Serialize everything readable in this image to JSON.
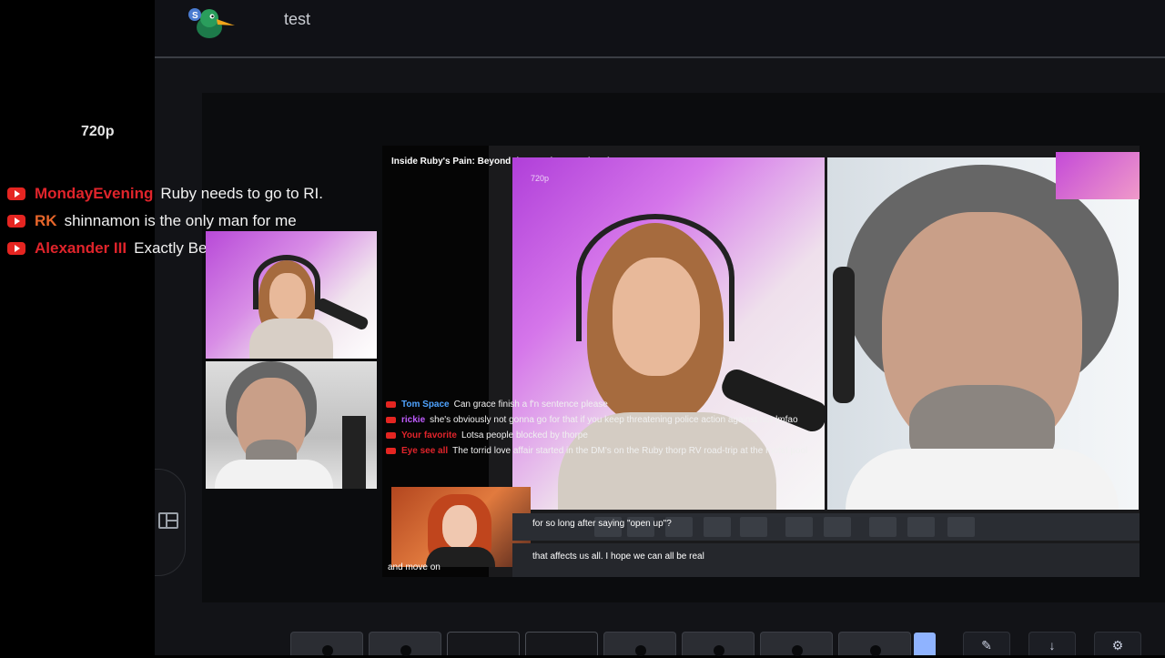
{
  "app": {
    "title": "test",
    "logo_icon": "duck-logo-icon"
  },
  "resolution_label": "720p",
  "chat": [
    {
      "name": "MondayEvening",
      "name_color": "#e0242b",
      "message": "Ruby needs to go to RI."
    },
    {
      "name": "RK",
      "name_color": "#e8662a",
      "message": "shinnamon is the only man for me"
    },
    {
      "name": "Alexander III",
      "name_color": "#e0242b",
      "message": "Exactly Ben"
    }
  ],
  "preview": {
    "header": "Inside Ruby's Pain: Beyond the Words \"Heartbreak\"",
    "resolution": "720p",
    "chat": [
      {
        "name": "Tom Space",
        "name_color": "#4fa3ff",
        "message": "Can grace finish a f'n sentence please"
      },
      {
        "name": "rickie",
        "name_color": "#c05cff",
        "message": "she's obviously not gonna go for that if you keep threatening police action against her lmfao"
      },
      {
        "name": "Your favorite",
        "name_color": "#e0242b",
        "message": "Lotsa people blocked by thorpe"
      },
      {
        "name": "Eye see all",
        "name_color": "#e0242b",
        "message": "The torrid love affair started in the DM's on the Ruby thorp RV road-trip at the motel pool"
      }
    ],
    "overlay_text_1": "for so long after saying \"open up\"?",
    "overlay_text_2": "that affects us all. I hope we can all be real",
    "bottom_text": "and move on"
  },
  "colors": {
    "accent": "#8fb3ff",
    "youtube_red": "#e52521"
  }
}
